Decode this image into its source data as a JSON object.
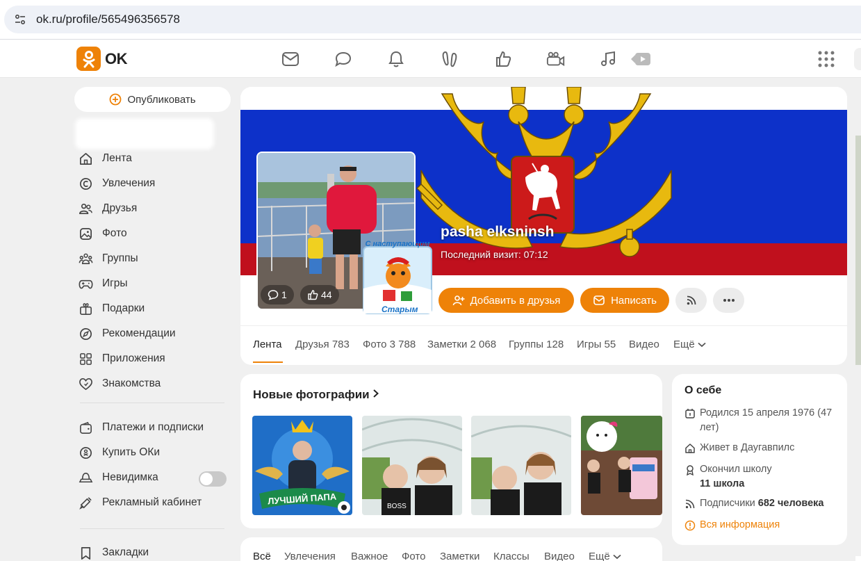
{
  "browser": {
    "url": "ok.ru/profile/565496356578"
  },
  "header": {
    "logo_text": "OK",
    "brand_color": "#ee8208",
    "icons": [
      "mail-icon",
      "chat-icon",
      "bell-icon",
      "guests-icon",
      "like-icon",
      "video-camera-icon",
      "music-icon",
      "video-play-icon",
      "apps-grid-icon"
    ]
  },
  "sidebar": {
    "publish_label": "Опубликовать",
    "items": [
      {
        "label": "Лента",
        "icon": "home-icon"
      },
      {
        "label": "Увлечения",
        "icon": "hobby-icon"
      },
      {
        "label": "Друзья",
        "icon": "friends-icon"
      },
      {
        "label": "Фото",
        "icon": "photo-icon"
      },
      {
        "label": "Группы",
        "icon": "groups-icon"
      },
      {
        "label": "Игры",
        "icon": "gamepad-icon"
      },
      {
        "label": "Подарки",
        "icon": "gift-icon"
      },
      {
        "label": "Рекомендации",
        "icon": "compass-icon"
      },
      {
        "label": "Приложения",
        "icon": "apps-icon"
      },
      {
        "label": "Знакомства",
        "icon": "heart-icon"
      }
    ],
    "items2": [
      {
        "label": "Платежи и подписки",
        "icon": "wallet-icon"
      },
      {
        "label": "Купить ОКи",
        "icon": "coin-icon"
      },
      {
        "label": "Невидимка",
        "icon": "invisible-icon"
      },
      {
        "label": "Рекламный кабинет",
        "icon": "megaphone-icon"
      }
    ],
    "items3": [
      {
        "label": "Закладки",
        "icon": "bookmark-icon"
      }
    ]
  },
  "profile": {
    "name": "pasha elksninsh",
    "last_visit": "Последний визит: 07:12",
    "sticker_top": "С наступающим",
    "sticker_bottom": "Старым",
    "comments_count": "1",
    "likes_count": "44",
    "add_friend_label": "Добавить в друзья",
    "message_label": "Написать",
    "tabs": [
      {
        "label": "Лента"
      },
      {
        "label": "Друзья 783"
      },
      {
        "label": "Фото 3 788"
      },
      {
        "label": "Заметки 2 068"
      },
      {
        "label": "Группы 128"
      },
      {
        "label": "Игры 55"
      },
      {
        "label": "Видео"
      },
      {
        "label": "Ещё"
      }
    ]
  },
  "photos": {
    "title": "Новые фотографии",
    "badge_text": "ЛУЧШИЙ ПАПА",
    "shirt_text": "BOSS"
  },
  "about": {
    "title": "О себе",
    "born": "Родился 15 апреля 1976 (47 лет)",
    "lives": "Живет в Даугавпилс",
    "school_prefix": "Окончил школу",
    "school": "11 школа",
    "subscribers_prefix": "Подписчики",
    "subscribers": "682 человека",
    "all_info": "Вся информация"
  },
  "feed_filters": [
    "Всё",
    "Увлечения",
    "Важное",
    "Фото",
    "Заметки",
    "Классы",
    "Видео",
    "Ещё"
  ]
}
